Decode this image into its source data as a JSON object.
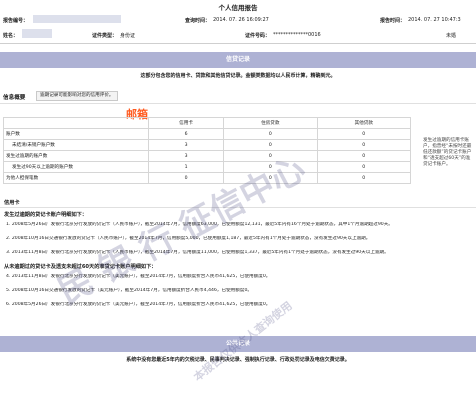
{
  "report": {
    "title": "个人信用报告",
    "report_no_label": "报告编号：",
    "query_time_label": "查询时间：",
    "query_time": "2014. 07. 26  16:09:27",
    "report_time_label": "报告时间：",
    "report_time": "2014. 07. 27  10:47:3",
    "name_label": "姓名：",
    "id_type_label": "证件类型：",
    "id_type": "身份证",
    "id_no_label": "证件号码：",
    "id_no": "**************0016",
    "marital": "未婚"
  },
  "credit_section": {
    "band": "信贷记录",
    "intro": "这部分包含您的信用卡、贷款和其他信贷记录。金额类数据均以人民币计算，精确到元。"
  },
  "overview": {
    "title": "信息概要",
    "tag": "逾期记录可能影响对您的信用评价。",
    "stamp_text": "邮箱",
    "columns": [
      "",
      "信用卡",
      "住房贷款",
      "其他贷款"
    ],
    "rows": [
      {
        "label": "账户数",
        "values": [
          "6",
          "0",
          "0"
        ]
      },
      {
        "label": "未结清/未销户账户数",
        "values": [
          "3",
          "0",
          "0"
        ]
      },
      {
        "label": "发生过逾期的账户数",
        "values": [
          "3",
          "0",
          "0"
        ]
      },
      {
        "label": "发生过90天以上逾期的账户数",
        "values": [
          "1",
          "0",
          "0"
        ]
      },
      {
        "label": "为他人担保笔数",
        "values": [
          "0",
          "0",
          "0"
        ]
      }
    ],
    "side_note": "发生过逾期的信用卡账户，指曾经“未按时还最低还款额”的贷记卡账户和“透支超过60天”的准贷记卡账户。"
  },
  "credit_card": {
    "heading": "信用卡",
    "overdue_title": "发生过逾期的贷记卡账户明细如下：",
    "overdue_items": [
      "1. 2008年5月26日广发银行北京分行发放的贷记卡（人民币账户），截至2014年7月，信用额度63,000，已使用额度12,131，最近5年内有16个月处于逾期状态，其中1个月逾期超过90天。",
      "2. 2008年10月16日交通银行发放的贷记卡（人民币账户），截至2014年7月，信用额度5,000，已使用额度1,187，最近5年内有1个月处于逾期状态，没有发生过90天以上逾期。",
      "3. 2013年11月8日广发银行北京分行发放的贷记卡（人民币账户），截至2014年7月，信用额度11,000，已使用额度1,337，最近5年内有1个月处于逾期状态，没有发生过90天以上逾期。"
    ],
    "normal_title": "从未逾期过的贷记卡及透支未超过60天的准贷记卡账户明细如下：",
    "normal_items": [
      "4. 2013年11月8日广发银行北京分行发放的贷记卡（美元账户），截至2014年7月，信用额度折合人民币41,625，已使用额度0。",
      "5. 2008年10月16日交通银行发放的贷记卡（美元账户），截至2014年7月，信用额度折合人民币4,446，已使用额度0。",
      "6. 2008年5月26日广发银行北京分行发放的贷记卡（美元账户），截至2014年7月，信用额度折合人民币41,625，已使用额度0。"
    ]
  },
  "public_section": {
    "band": "公共记录",
    "note": "系统中没有您最近5年内的欠税记录、民事判决记录、强制执行记录、行政处罚记录及电信欠费记录。"
  },
  "watermark": {
    "line1": "民  银  行  征信中心",
    "line2": "本报告仅供本人查询使用"
  }
}
